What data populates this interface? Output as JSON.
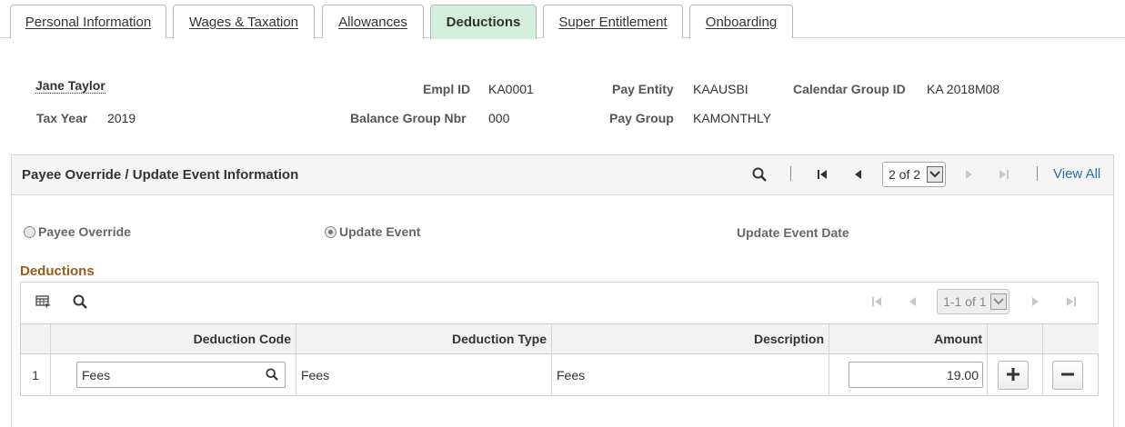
{
  "tabs": [
    {
      "label": "Personal Information",
      "active": false
    },
    {
      "label": "Wages & Taxation",
      "active": false
    },
    {
      "label": "Allowances",
      "active": false
    },
    {
      "label": "Deductions",
      "active": true
    },
    {
      "label": "Super Entitlement",
      "active": false
    },
    {
      "label": "Onboarding",
      "active": false
    }
  ],
  "employee": {
    "name": "Jane Taylor",
    "tax_year_label": "Tax Year",
    "tax_year": "2019",
    "empl_id_label": "Empl ID",
    "empl_id": "KA0001",
    "balance_group_label": "Balance Group Nbr",
    "balance_group": "000",
    "pay_entity_label": "Pay Entity",
    "pay_entity": "KAAUSBI",
    "pay_group_label": "Pay Group",
    "pay_group": "KAMONTHLY",
    "calendar_group_label": "Calendar Group ID",
    "calendar_group": "KA 2018M08"
  },
  "panel": {
    "title": "Payee Override / Update Event Information",
    "pager": "2 of 2",
    "view_all": "View All",
    "payee_override_label": "Payee Override",
    "payee_override_checked": false,
    "update_event_label": "Update Event",
    "update_event_checked": true,
    "update_event_date_label": "Update Event Date"
  },
  "deductions": {
    "title": "Deductions",
    "pager": "1-1 of 1",
    "columns": [
      "Deduction Code",
      "Deduction Type",
      "Description",
      "Amount"
    ],
    "rows": [
      {
        "num": "1",
        "code": "Fees",
        "type": "Fees",
        "description": "Fees",
        "amount": "19.00"
      }
    ]
  },
  "icons": {
    "search": "search-icon",
    "first": "first-page-icon",
    "prev": "previous-icon",
    "next": "next-icon",
    "last": "last-page-icon",
    "grid_personalize": "personalize-grid-icon",
    "add": "plus-icon",
    "delete": "minus-icon"
  }
}
